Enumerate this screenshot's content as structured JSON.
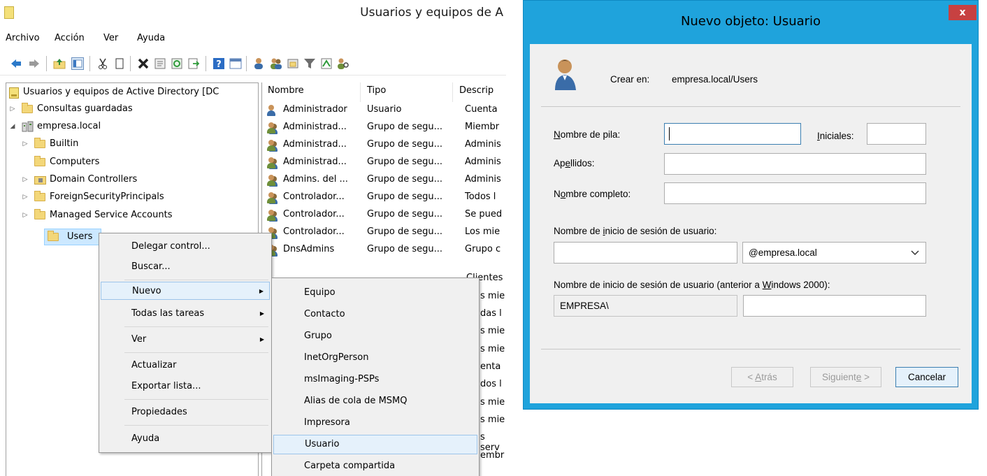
{
  "window_title": "Usuarios y equipos de A",
  "menu": [
    "Archivo",
    "Acción",
    "Ver",
    "Ayuda"
  ],
  "tree": {
    "root": "Usuarios y equipos de Active Directory [DC",
    "saved_queries": "Consultas guardadas",
    "domain": "empresa.local",
    "children": [
      "Builtin",
      "Computers",
      "Domain Controllers",
      "ForeignSecurityPrincipals",
      "Managed Service Accounts",
      "Users"
    ]
  },
  "list": {
    "columns": [
      "Nombre",
      "Tipo",
      "Descrip"
    ],
    "rows": [
      {
        "name": "Administrador",
        "type": "Usuario",
        "desc": "Cuenta"
      },
      {
        "name": "Administrad...",
        "type": "Grupo de segu...",
        "desc": "Miembr"
      },
      {
        "name": "Administrad...",
        "type": "Grupo de segu...",
        "desc": "Adminis"
      },
      {
        "name": "Administrad...",
        "type": "Grupo de segu...",
        "desc": "Adminis"
      },
      {
        "name": "Admins. del ...",
        "type": "Grupo de segu...",
        "desc": "Adminis"
      },
      {
        "name": "Controlador...",
        "type": "Grupo de segu...",
        "desc": "Todos l"
      },
      {
        "name": "Controlador...",
        "type": "Grupo de segu...",
        "desc": "Se pued"
      },
      {
        "name": "Controlador...",
        "type": "Grupo de segu...",
        "desc": "Los mie"
      },
      {
        "name": "DnsAdmins",
        "type": "Grupo de segu...",
        "desc": "Grupo c"
      }
    ],
    "partial_desc": [
      "Clientes",
      "s mie",
      "das l",
      "s mie",
      "s mie",
      "enta",
      "dos l",
      "s mie",
      "s mie",
      "s serv",
      "embr"
    ]
  },
  "context_menu": {
    "items": [
      "Delegar control...",
      "Buscar...",
      "Nuevo",
      "Todas las tareas",
      "Ver",
      "Actualizar",
      "Exportar lista...",
      "Propiedades",
      "Ayuda"
    ]
  },
  "submenu": {
    "items": [
      "Equipo",
      "Contacto",
      "Grupo",
      "InetOrgPerson",
      "msImaging-PSPs",
      "Alias de cola de MSMQ",
      "Impresora",
      "Usuario",
      "Carpeta compartida"
    ]
  },
  "dialog": {
    "title": "Nuevo objeto: Usuario",
    "close": "x",
    "create_in_label": "Crear en:",
    "create_in_value": "empresa.local/Users",
    "first_name_label_u": "N",
    "first_name_label_rest": "ombre de pila:",
    "initials_label_u": "I",
    "initials_label_rest": "niciales:",
    "last_name_label_pre": "Ap",
    "last_name_label_u": "e",
    "last_name_label_rest": "llidos:",
    "full_name_label_pre": "N",
    "full_name_label_u": "o",
    "full_name_label_rest": "mbre completo:",
    "logon_label_pre": "Nombre de ",
    "logon_label_u": "i",
    "logon_label_rest": "nicio de sesión de usuario:",
    "domain_suffix": "@empresa.local",
    "legacy_label_pre": "Nombre de inicio de sesión de usuario (anterior a ",
    "legacy_label_u": "W",
    "legacy_label_rest": "indows 2000):",
    "legacy_domain": "EMPRESA\\",
    "btn_back_pre": "< ",
    "btn_back_u": "A",
    "btn_back_rest": "trás",
    "btn_next_pre": "Siguient",
    "btn_next_u": "e",
    "btn_next_rest": " >",
    "btn_cancel": "Cancelar"
  }
}
